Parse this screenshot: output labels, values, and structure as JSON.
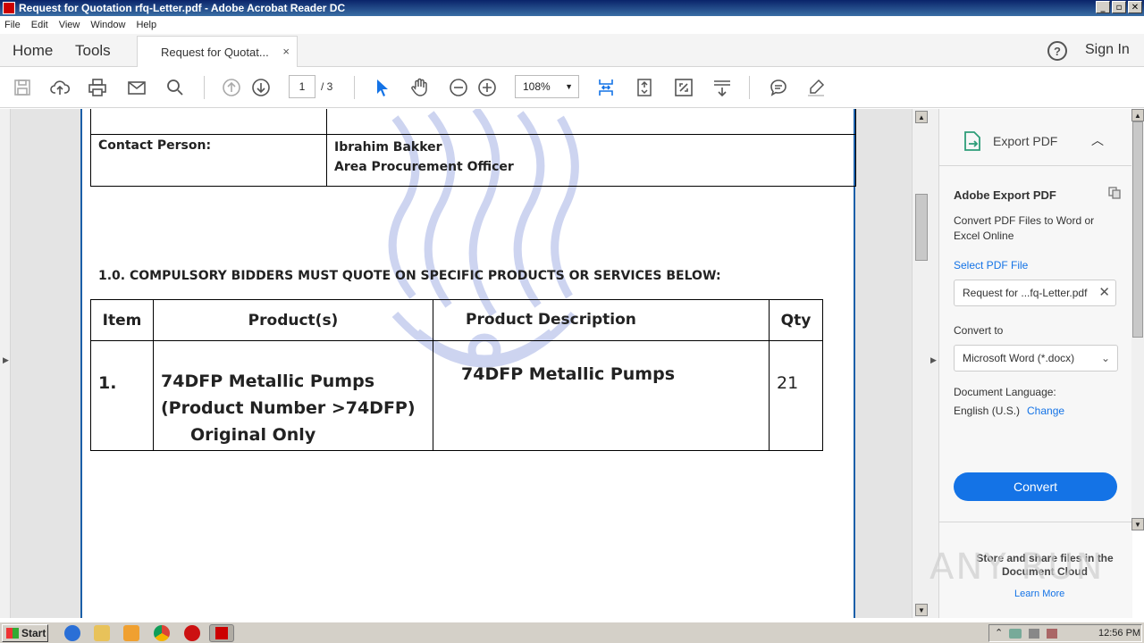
{
  "window": {
    "title": "Request for Quotation rfq-Letter.pdf - Adobe Acrobat Reader DC",
    "buttons": [
      "_",
      "▫",
      "✕"
    ]
  },
  "menu": [
    "File",
    "Edit",
    "View",
    "Window",
    "Help"
  ],
  "tabs": {
    "home": "Home",
    "tools": "Tools",
    "document": "Request for Quotat...",
    "close": "×",
    "help": "?",
    "sign_in": "Sign In"
  },
  "toolbar": {
    "page_current": "1",
    "page_total": "/ 3",
    "zoom": "108%",
    "zoom_caret": "▼"
  },
  "document": {
    "contact_label": "Contact Person:",
    "contact_name": "Ibrahim Bakker",
    "contact_title": "Area Procurement Officer",
    "section_title": "1.0. COMPULSORY BIDDERS MUST QUOTE ON SPECIFIC PRODUCTS OR SERVICES BELOW:",
    "headers": {
      "item": "Item",
      "product": "Product(s)",
      "description": "Product Description",
      "qty": "Qty"
    },
    "row": {
      "item": "1.",
      "product_line1": "74DFP Metallic Pumps",
      "product_line2": "(Product Number >74DFP)",
      "product_line3": "Original Only",
      "description": "74DFP Metallic Pumps",
      "qty": "21"
    }
  },
  "panel": {
    "title": "Export PDF",
    "heading": "Adobe Export PDF",
    "desc": "Convert PDF Files to Word or Excel Online",
    "select_label": "Select PDF File",
    "file_name": "Request for ...fq-Letter.pdf",
    "convert_to_label": "Convert to",
    "format": "Microsoft Word (*.docx)",
    "language_label": "Document Language:",
    "language": "English (U.S.)",
    "change": "Change",
    "convert_button": "Convert",
    "cloud_text": "Store and share files in the Document Cloud",
    "learn_more": "Learn More"
  },
  "taskbar": {
    "start": "Start",
    "clock": "12:56 PM"
  },
  "colors": {
    "accent": "#1473e6",
    "page_border": "#1b5fa8",
    "title_bar": "#0a246a"
  },
  "watermark_text": "ANY RUN"
}
